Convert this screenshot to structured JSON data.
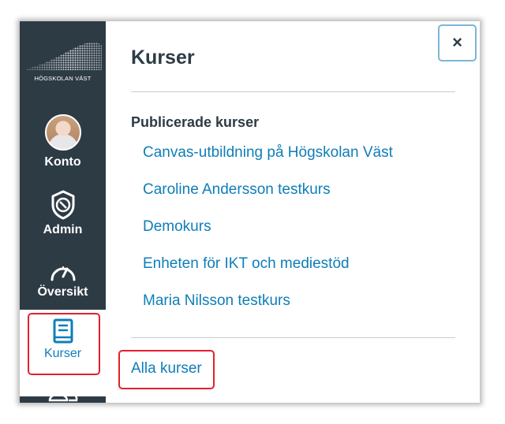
{
  "logo": {
    "text": "HÖGSKOLAN VÄST"
  },
  "global_nav": {
    "items": [
      {
        "label": "Konto",
        "icon": "avatar-icon"
      },
      {
        "label": "Admin",
        "icon": "shield-icon"
      },
      {
        "label": "Översikt",
        "icon": "dashboard-icon"
      },
      {
        "label": "Kurser",
        "icon": "book-icon",
        "active": true
      },
      {
        "label": "",
        "icon": "groups-icon"
      }
    ]
  },
  "tray": {
    "close_label": "×",
    "title": "Kurser",
    "section_title": "Publicerade kurser",
    "courses": [
      "Canvas-utbildning på Högskolan Väst",
      "Caroline Andersson testkurs",
      "Demokurs",
      "Enheten för IKT och mediestöd",
      "Maria Nilsson testkurs"
    ],
    "all_courses_label": "Alla kurser"
  },
  "colors": {
    "nav_background": "#2d3b45",
    "link": "#0e7eb8",
    "highlight": "#e0212e",
    "close_border": "#7bb6d6"
  }
}
